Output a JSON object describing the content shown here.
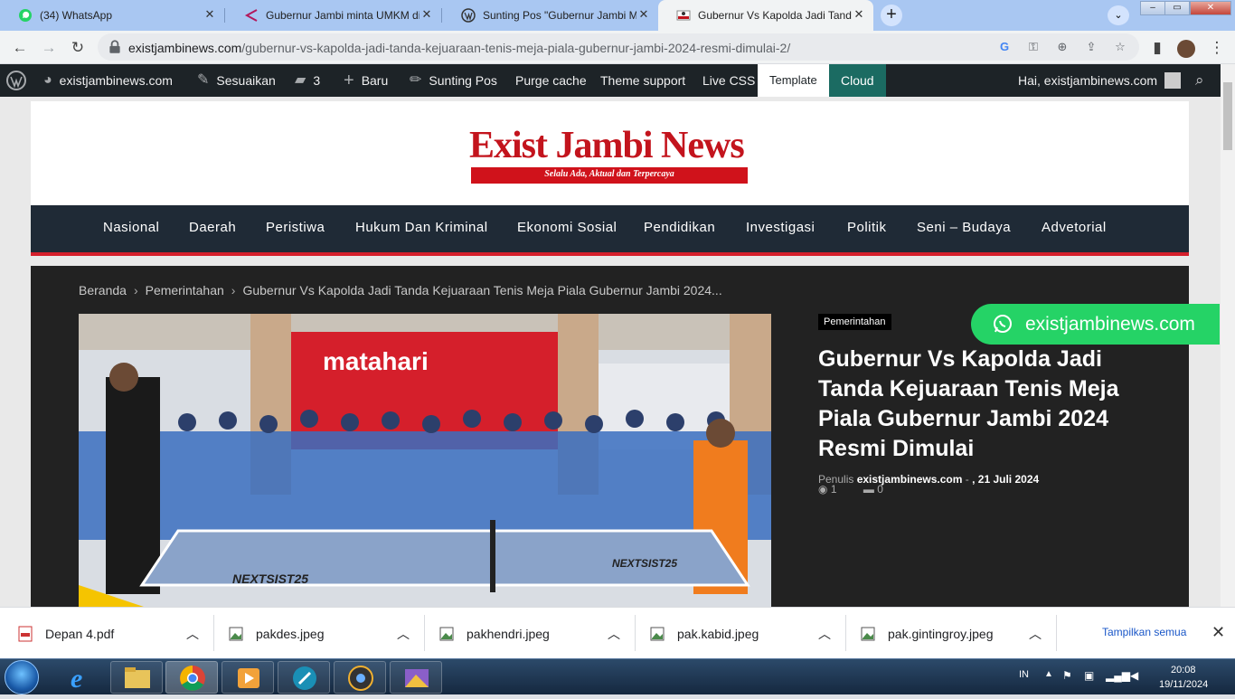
{
  "browser": {
    "tabs": [
      {
        "title": "(34) WhatsApp",
        "icon": "whatsapp-icon",
        "active": false
      },
      {
        "title": "Gubernur Jambi minta UMKM di",
        "icon": "site-favicon",
        "active": false
      },
      {
        "title": "Sunting Pos \"Gubernur Jambi Mi",
        "icon": "wordpress-icon",
        "active": false
      },
      {
        "title": "Gubernur Vs Kapolda Jadi Tanda",
        "icon": "site-favicon",
        "active": true
      }
    ],
    "url_host": "existjambinews.com",
    "url_path": "/gubernur-vs-kapolda-jadi-tanda-kejuaraan-tenis-meja-piala-gubernur-jambi-2024-resmi-dimulai-2/"
  },
  "adminbar": {
    "site": "existjambinews.com",
    "customize": "Sesuaikan",
    "comments": "3",
    "new": "Baru",
    "edit": "Sunting Pos",
    "purge": "Purge cache",
    "theme_support": "Theme support",
    "live_css": "Live CSS",
    "template": "Template",
    "cloud": "Cloud",
    "greeting": "Hai, existjambinews.com"
  },
  "logo": {
    "text": "Exist Jambi News",
    "tagline": "Selalu Ada, Aktual dan Terpercaya"
  },
  "nav": [
    "Nasional",
    "Daerah",
    "Peristiwa",
    "Hukum Dan Kriminal",
    "Ekonomi Sosial",
    "Pendidikan",
    "Investigasi",
    "Politik",
    "Seni – Budaya",
    "Advetorial"
  ],
  "breadcrumb": {
    "home": "Beranda",
    "category": "Pemerintahan",
    "current": "Gubernur Vs Kapolda Jadi Tanda Kejuaraan Tenis Meja Piala Gubernur Jambi 2024..."
  },
  "post": {
    "category": "Pemerintahan",
    "title": "Gubernur Vs Kapolda Jadi Tanda Kejuaraan Tenis Meja Piala Gubernur Jambi 2024 Resmi Dimulai",
    "author_label": "Penulis",
    "author": "existjambinews.com",
    "date_sep": "-",
    "date": ", 21 Juli 2024",
    "views": "1",
    "comments": "0",
    "photo_sign": "matahari",
    "table_brand": "NEXTSIST25"
  },
  "whatsapp_button": "existjambinews.com",
  "downloads": {
    "items": [
      {
        "name": "Depan 4.pdf",
        "type": "pdf"
      },
      {
        "name": "pakdes.jpeg",
        "type": "image"
      },
      {
        "name": "pakhendri.jpeg",
        "type": "image"
      },
      {
        "name": "pak.kabid.jpeg",
        "type": "image"
      },
      {
        "name": "pak.gintingroy.jpeg",
        "type": "image"
      }
    ],
    "show_all": "Tampilkan semua"
  },
  "taskbar": {
    "lang": "IN",
    "time": "20:08",
    "date": "19/11/2024"
  },
  "colors": {
    "accent_red": "#d51f2b",
    "nav_bg": "#1f2a36",
    "whatsapp_green": "#25d366",
    "adminbar_bg": "#1d2327",
    "cloud_bg": "#1b6b62"
  }
}
